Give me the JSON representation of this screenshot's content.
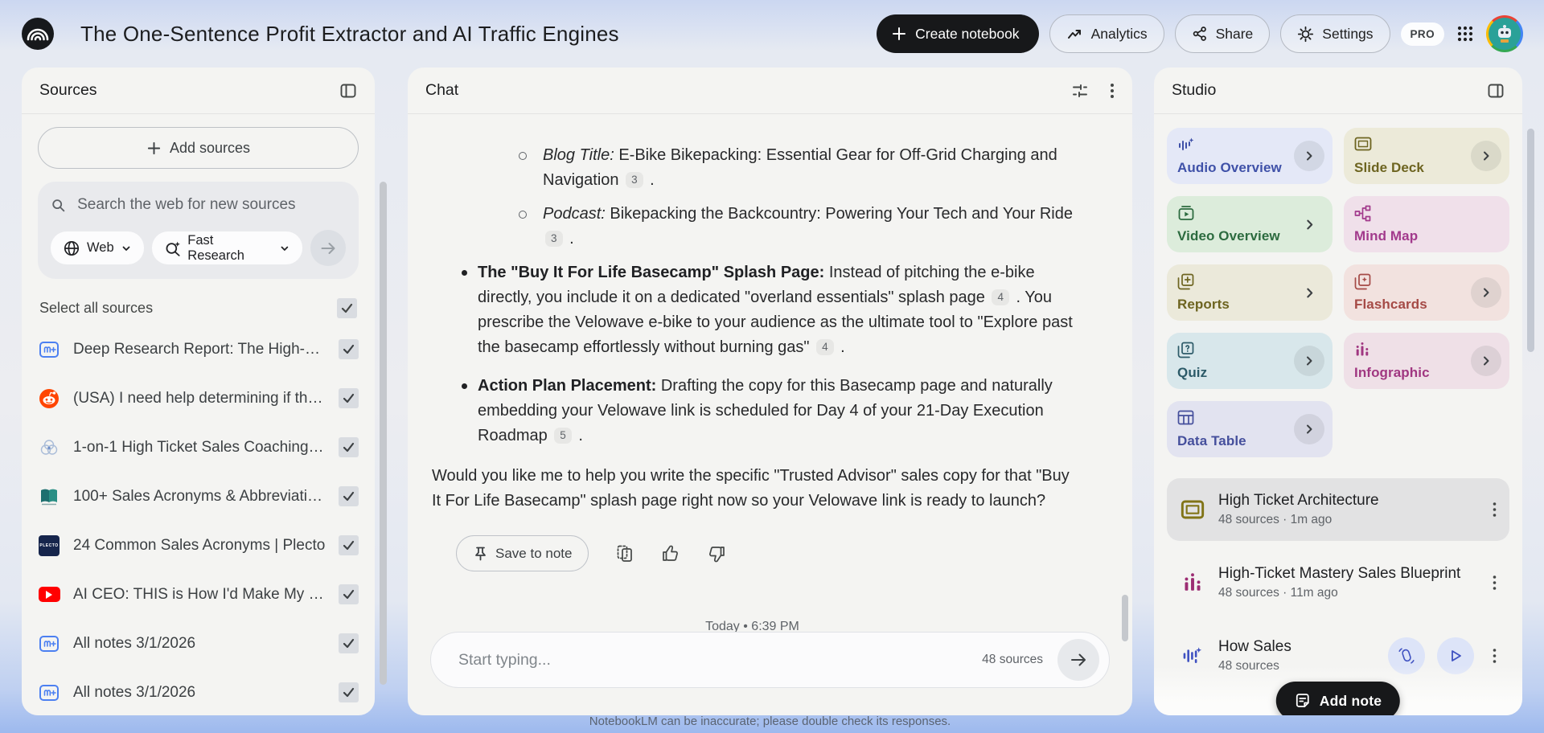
{
  "header": {
    "title": "The One-Sentence Profit Extractor and AI Traffic Engines",
    "create_notebook_label": "Create notebook",
    "analytics_label": "Analytics",
    "share_label": "Share",
    "settings_label": "Settings",
    "pro_badge": "PRO"
  },
  "colors": {
    "dark_button": "#17181a",
    "page_bottom_blue": "#9db9ee",
    "panel_background": "#f4f4f2"
  },
  "sources": {
    "panel_title": "Sources",
    "add_sources_label": "Add sources",
    "search_placeholder": "Search the web for new sources",
    "web_dropdown": "Web",
    "research_dropdown": "Fast Research",
    "select_all_label": "Select all sources",
    "items": [
      {
        "title": "Deep Research Report: The High-Tick...",
        "icon": "note-icon",
        "checked": true
      },
      {
        "title": "(USA) I need help determining if this r...",
        "icon": "reddit-icon",
        "checked": true
      },
      {
        "title": "1-on-1 High Ticket Sales Coaching - K...",
        "icon": "web-source-icon",
        "checked": true
      },
      {
        "title": "100+ Sales Acronyms & Abbreviations...",
        "icon": "book-icon",
        "checked": true
      },
      {
        "title": "24 Common Sales Acronyms | Plecto",
        "icon": "plecto-icon",
        "checked": true
      },
      {
        "title": "AI CEO: THIS is How I'd Make My First ...",
        "icon": "youtube-icon",
        "checked": true
      },
      {
        "title": "All notes 3/1/2026",
        "icon": "note-icon",
        "checked": true
      },
      {
        "title": "All notes 3/1/2026",
        "icon": "note-icon",
        "checked": true
      }
    ]
  },
  "chat": {
    "panel_title": "Chat",
    "message": {
      "sub_bullets": [
        {
          "lead": "Blog Title:",
          "text": "E-Bike Bikepacking: Essential Gear for Off-Grid Charging and Navigation",
          "citation": "3",
          "tail": "."
        },
        {
          "lead": "Podcast:",
          "text": "Bikepacking the Backcountry: Powering Your Tech and Your Ride",
          "citation": "3",
          "tail": "."
        }
      ],
      "bullets": [
        {
          "lead": "The \"Buy It For Life Basecamp\" Splash Page:",
          "seg1": "Instead of pitching the e-bike directly, you include it on a dedicated \"overland essentials\" splash page",
          "cit1": "4",
          "seg2": ". You prescribe the Velowave e-bike to your audience as the ultimate tool to \"Explore past the basecamp effortlessly without burning gas\"",
          "cit2": "4",
          "tail": "."
        },
        {
          "lead": "Action Plan Placement:",
          "text": "Drafting the copy for this Basecamp page and naturally embedding your Velowave link is scheduled for Day 4 of your 21-Day Execution Roadmap",
          "citation": "5",
          "tail": "."
        }
      ],
      "closing": "Would you like me to help you write the specific \"Trusted Advisor\" sales copy for that \"Buy It For Life Basecamp\" splash page right now so your Velowave link is ready to launch?"
    },
    "actions": {
      "save_to_note": "Save to note"
    },
    "divider": "Today • 6:39 PM",
    "input": {
      "placeholder": "Start typing...",
      "sources_count": "48 sources"
    },
    "disclaimer": "NotebookLM can be inaccurate; please double check its responses."
  },
  "studio": {
    "panel_title": "Studio",
    "tiles": [
      {
        "label": "Audio Overview",
        "icon": "audio-overview-icon",
        "bg": "#e4e8f7",
        "color": "#3f51a8",
        "chevron": "circle"
      },
      {
        "label": "Slide Deck",
        "icon": "slide-deck-icon",
        "bg": "#ecead9",
        "color": "#6d6420",
        "chevron": "circle"
      },
      {
        "label": "Video Overview",
        "icon": "video-overview-icon",
        "bg": "#dcecdb",
        "color": "#2c6b3f",
        "chevron": "plain"
      },
      {
        "label": "Mind Map",
        "icon": "mind-map-icon",
        "bg": "#f0e0ea",
        "color": "#a23a8c",
        "chevron": "none"
      },
      {
        "label": "Reports",
        "icon": "reports-icon",
        "bg": "#ebe9da",
        "color": "#6d6420",
        "chevron": "plain"
      },
      {
        "label": "Flashcards",
        "icon": "flashcards-icon",
        "bg": "#f2e2df",
        "color": "#a54a46",
        "chevron": "circle"
      },
      {
        "label": "Quiz",
        "icon": "quiz-icon",
        "bg": "#d8e7eb",
        "color": "#2c5a68",
        "chevron": "circle"
      },
      {
        "label": "Infographic",
        "icon": "infographic-icon",
        "bg": "#efe0e7",
        "color": "#a03781",
        "chevron": "circle"
      },
      {
        "label": "Data Table",
        "icon": "data-table-icon",
        "bg": "#e2e3f0",
        "color": "#454f9c",
        "chevron": "circle"
      }
    ],
    "items": [
      {
        "title": "High Ticket Architecture",
        "meta": "48 sources · 1m ago",
        "icon": "slide-deck-icon",
        "selected": true
      },
      {
        "title": "High-Ticket Mastery Sales Blueprint",
        "meta": "48 sources · 11m ago",
        "icon": "infographic-icon",
        "selected": false
      },
      {
        "title": "How Sales",
        "meta": "48 sources",
        "icon": "audio-overview-icon",
        "selected": false
      }
    ],
    "add_note_label": "Add note"
  }
}
